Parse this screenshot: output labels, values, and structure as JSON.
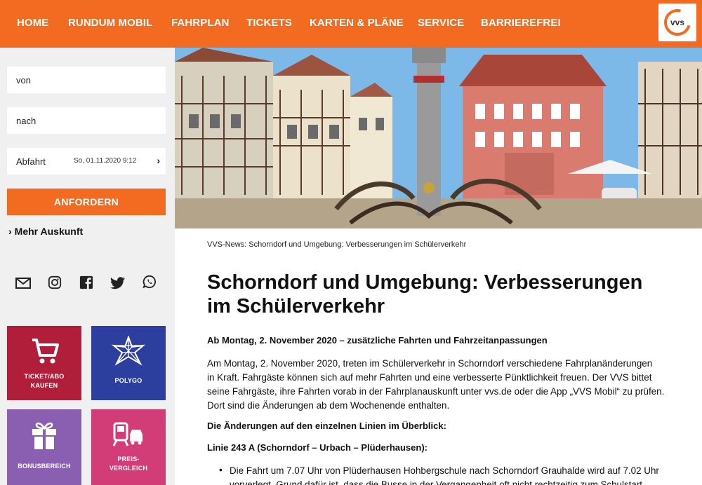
{
  "nav": {
    "items": [
      "HOME",
      "RUNDUM MOBIL",
      "FAHRPLAN",
      "TICKETS",
      "KARTEN & PLÄNE",
      "SERVICE",
      "BARRIEREFREI"
    ],
    "logo_text": "vvs"
  },
  "sidebar": {
    "from_label": "von",
    "to_label": "nach",
    "departure_label": "Abfahrt",
    "departure_value": "So, 01.11.2020 9:12",
    "request_button": "ANFORDERN",
    "more_info": "Mehr Auskunft",
    "social_icons": [
      "mail-icon",
      "instagram-icon",
      "facebook-icon",
      "twitter-icon",
      "whatsapp-icon"
    ],
    "tiles": [
      {
        "label_line1": "TICKET/ABO",
        "label_line2": "KAUFEN",
        "color": "#b01e3a",
        "icon": "shopping-cart-icon"
      },
      {
        "label_line1": "POLYGO",
        "label_line2": "",
        "color": "#2c3f9e",
        "icon": "polygo-star-icon"
      },
      {
        "label_line1": "BONUSBEREICH",
        "label_line2": "",
        "color": "#8a5fb2",
        "icon": "gift-icon"
      },
      {
        "label_line1": "PREIS-",
        "label_line2": "VERGLEICH",
        "color": "#d23c77",
        "icon": "train-car-icon"
      }
    ]
  },
  "article": {
    "breadcrumb": "VVS-News: Schorndorf und Umgebung: Verbesserungen im Schülerverkehr",
    "title_line1": "Schorndorf und Umgebung: Verbesserungen",
    "title_line2": "im Schülerverkehr",
    "subhead": "Ab Montag, 2. November 2020 – zusätzliche Fahrten und Fahrzeitanpassungen",
    "body_line1": "Am Montag, 2. November 2020, treten im Schülerverkehr in Schorndorf verschiedene Fahrplanänderungen",
    "body_line2": "in Kraft. Fahrgäste können sich auf mehr Fahrten und eine verbesserte Pünktlichkeit freuen. Der VVS bittet",
    "body_line3": "seine Fahrgäste, ihre Fahrten vorab in der Fahrplanauskunft unter vvs.de oder die App „VVS Mobil“ zu prüfen.",
    "body_line4": "Dort sind die Änderungen ab dem Wochenende enthalten.",
    "overview_heading": "Die Änderungen auf den einzelnen Linien im Überblick:",
    "line_heading": "Linie 243 A (Schorndorf – Urbach – Plüderhausen):",
    "bullet_line1": "Die Fahrt um 7.07 Uhr von Plüderhausen Hohbergschule nach Schorndorf Grauhalde wird auf 7.02 Uhr",
    "bullet_line2": "vorverlegt. Grund dafür ist, dass die Busse in der Vergangenheit oft nicht rechtzeitig zum Schulstart"
  }
}
